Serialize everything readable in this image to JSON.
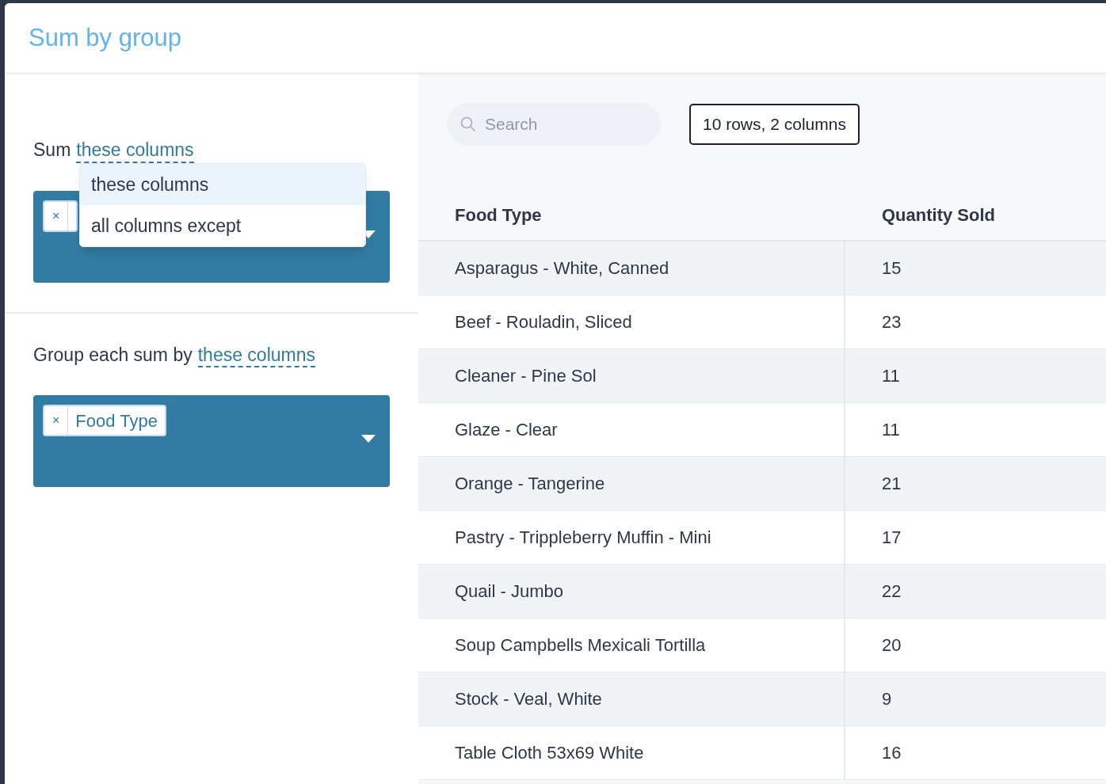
{
  "dialog": {
    "title": "Sum by group"
  },
  "sum_section": {
    "label": "Sum",
    "link": "these columns",
    "chips": [
      {
        "remove": "×"
      }
    ],
    "menu": [
      {
        "label": "these columns",
        "selected": true
      },
      {
        "label": "all columns except",
        "selected": false
      }
    ]
  },
  "group_section": {
    "label": "Group each sum by",
    "link": "these columns",
    "chips": [
      {
        "remove": "×",
        "label": "Food Type"
      }
    ]
  },
  "search": {
    "placeholder": "Search"
  },
  "summary": "10 rows, 2 columns",
  "table": {
    "columns": [
      "Food Type",
      "Quantity Sold"
    ],
    "rows": [
      [
        "Asparagus - White, Canned",
        "15"
      ],
      [
        "Beef - Rouladin, Sliced",
        "23"
      ],
      [
        "Cleaner - Pine Sol",
        "11"
      ],
      [
        "Glaze - Clear",
        "11"
      ],
      [
        "Orange - Tangerine",
        "21"
      ],
      [
        "Pastry - Trippleberry Muffin - Mini",
        "17"
      ],
      [
        "Quail - Jumbo",
        "22"
      ],
      [
        "Soup Campbells Mexicali Tortilla",
        "20"
      ],
      [
        "Stock - Veal, White",
        "9"
      ],
      [
        "Table Cloth 53x69 White",
        "16"
      ]
    ]
  }
}
